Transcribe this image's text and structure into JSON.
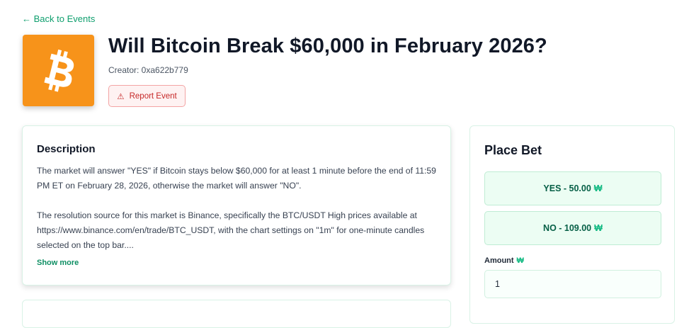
{
  "nav": {
    "back_label": "← Back to Events"
  },
  "event": {
    "logo_icon": "bitcoin-icon",
    "logo_color": "#f7931a",
    "title": "Will Bitcoin Break $60,000 in February 2026?",
    "creator": "Creator: 0xa622b779",
    "report_icon": "⚠",
    "report_label": "Report Event"
  },
  "description": {
    "heading": "Description",
    "paragraphs": [
      "The market will answer \"YES\" if Bitcoin stays below $60,000 for at least 1 minute before the end of 11:59 PM ET on February 28, 2026, otherwise the market will answer \"NO\".",
      "The resolution source for this market is Binance, specifically the BTC/USDT High prices available at https://www.binance.com/en/trade/BTC_USDT, with the chart settings on \"1m\" for one-minute candles selected on the top bar...."
    ],
    "show_more": "Show more"
  },
  "bet": {
    "heading": "Place Bet",
    "options": [
      {
        "label": "YES - 50.00"
      },
      {
        "label": "NO - 109.00"
      }
    ],
    "currency_symbol": "₩",
    "amount_label": "Amount",
    "amount_value": "1",
    "accent_color": "#10b981"
  }
}
